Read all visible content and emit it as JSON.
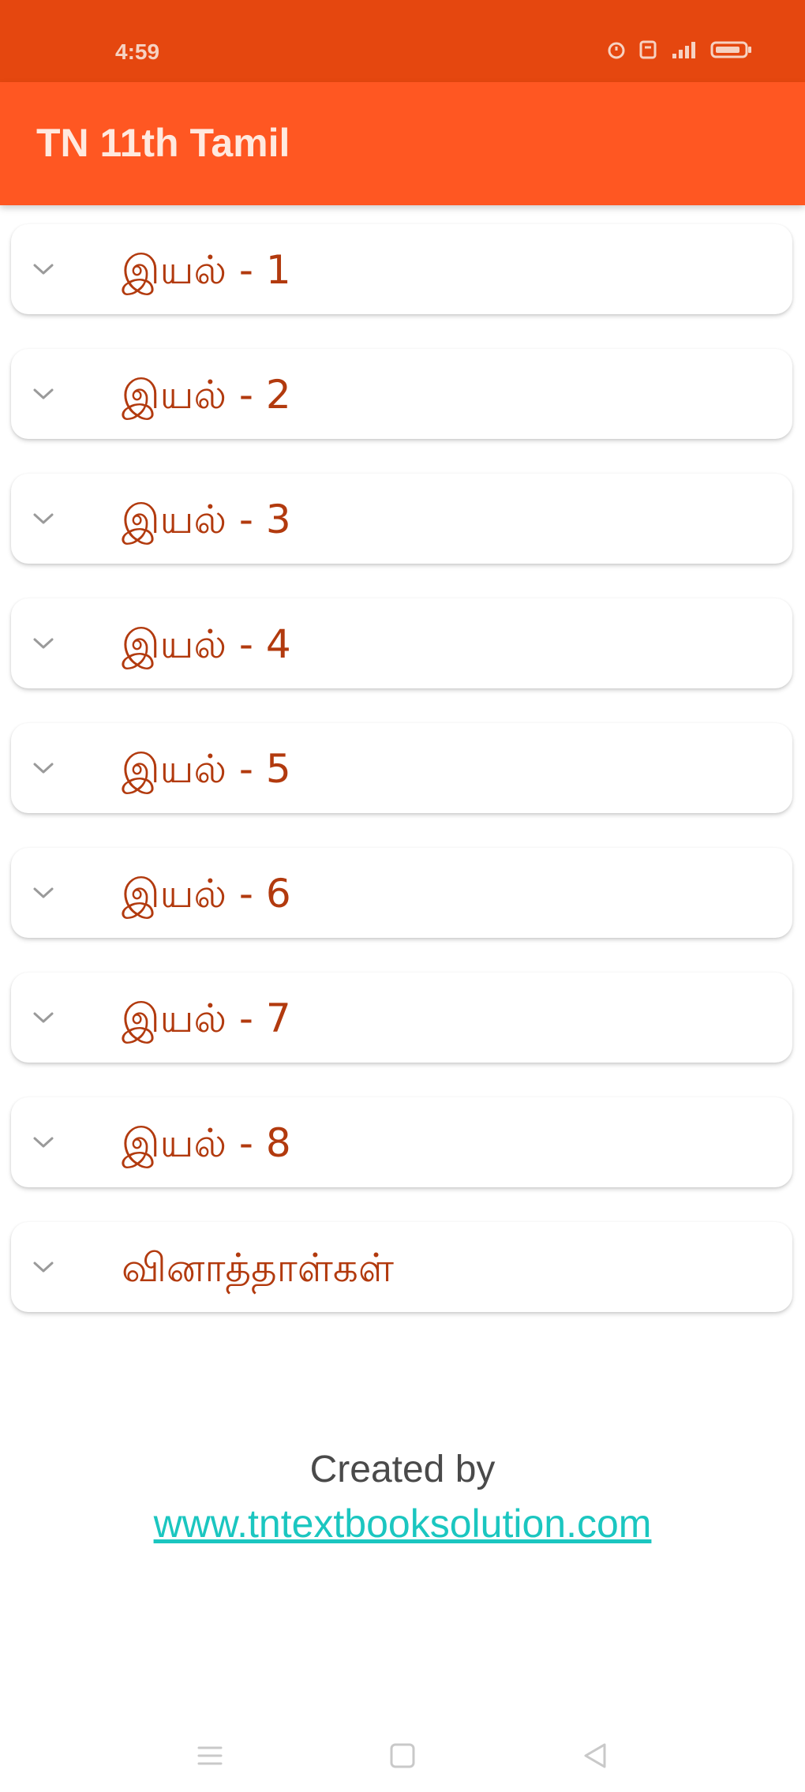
{
  "status_bar": {
    "time": "4:59",
    "icons": [
      "alarm-icon",
      "sim-icon",
      "signal-icon",
      "battery-icon"
    ]
  },
  "app_bar": {
    "title": "TN 11th Tamil"
  },
  "accent_colors": {
    "status_bar": "#E5470F",
    "app_bar": "#FF5722",
    "item_text": "#B23A0E",
    "link": "#1BC6C0"
  },
  "list": {
    "items": [
      {
        "label": "இயல் - 1"
      },
      {
        "label": "இயல் - 2"
      },
      {
        "label": "இயல் - 3"
      },
      {
        "label": "இயல் - 4"
      },
      {
        "label": "இயல் - 5"
      },
      {
        "label": "இயல் - 6"
      },
      {
        "label": "இயல் - 7"
      },
      {
        "label": "இயல் - 8"
      },
      {
        "label": "வினாத்தாள்கள்"
      }
    ]
  },
  "footer": {
    "created_by": "Created by",
    "link": "www.tntextbooksolution.com"
  },
  "nav_bar": {
    "buttons": [
      "menu-icon",
      "home-icon",
      "back-icon"
    ]
  }
}
